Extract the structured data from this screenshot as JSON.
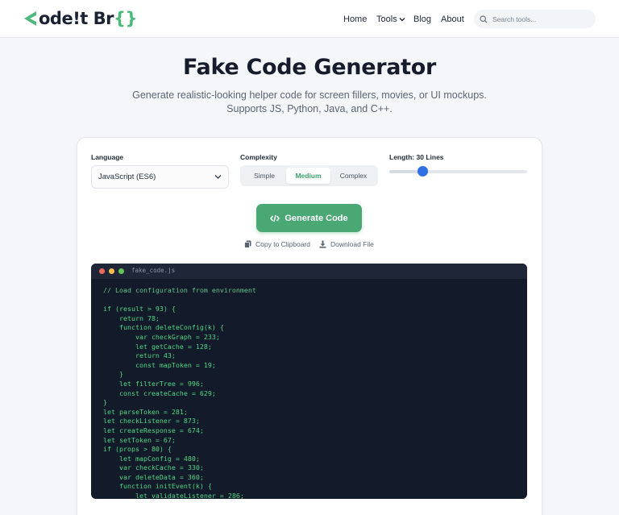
{
  "brand": {
    "logo_text_a": "ode",
    "logo_text_b": "!t Br",
    "logo_text_c": "{}"
  },
  "nav": {
    "home": "Home",
    "tools": "Tools",
    "blog": "Blog",
    "about": "About"
  },
  "search": {
    "placeholder": "Search tools..."
  },
  "hero": {
    "title": "Fake Code Generator",
    "subtitle_line1": "Generate realistic-looking helper code for screen fillers, movies, or UI mockups.",
    "subtitle_line2": "Supports JS, Python, Java, and C++."
  },
  "controls": {
    "language_label": "Language",
    "language_value": "JavaScript (ES6)",
    "complexity_label": "Complexity",
    "complexity_options": [
      "Simple",
      "Medium",
      "Complex"
    ],
    "complexity_selected": "Medium",
    "length_label": "Length: 30 Lines",
    "length_value": 30,
    "length_fraction": 0.24
  },
  "actions": {
    "generate": "Generate Code",
    "copy": "Copy to Clipboard",
    "download": "Download File"
  },
  "colors": {
    "accent": "#49a874",
    "slider_thumb": "#2f6fe4",
    "code_bg": "#131a29",
    "code_text": "#4fd685"
  },
  "code": {
    "filename": "fake_code.js",
    "lines": [
      "// Load configuration from environment",
      "",
      "if (result > 93) {",
      "    return 78;",
      "    function deleteConfig(k) {",
      "        var checkGraph = 233;",
      "        let getCache = 128;",
      "        return 43;",
      "        const mapToken = 19;",
      "    }",
      "    let filterTree = 996;",
      "    const createCache = 629;",
      "}",
      "let parseToken = 281;",
      "let checkListener = 873;",
      "let createResponse = 674;",
      "let setToken = 67;",
      "if (props > 80) {",
      "    let mapConfig = 480;",
      "    var checkCache = 330;",
      "    var deleteData = 360;",
      "    function initEvent(k) {",
      "        let validateListener = 286;"
    ]
  }
}
